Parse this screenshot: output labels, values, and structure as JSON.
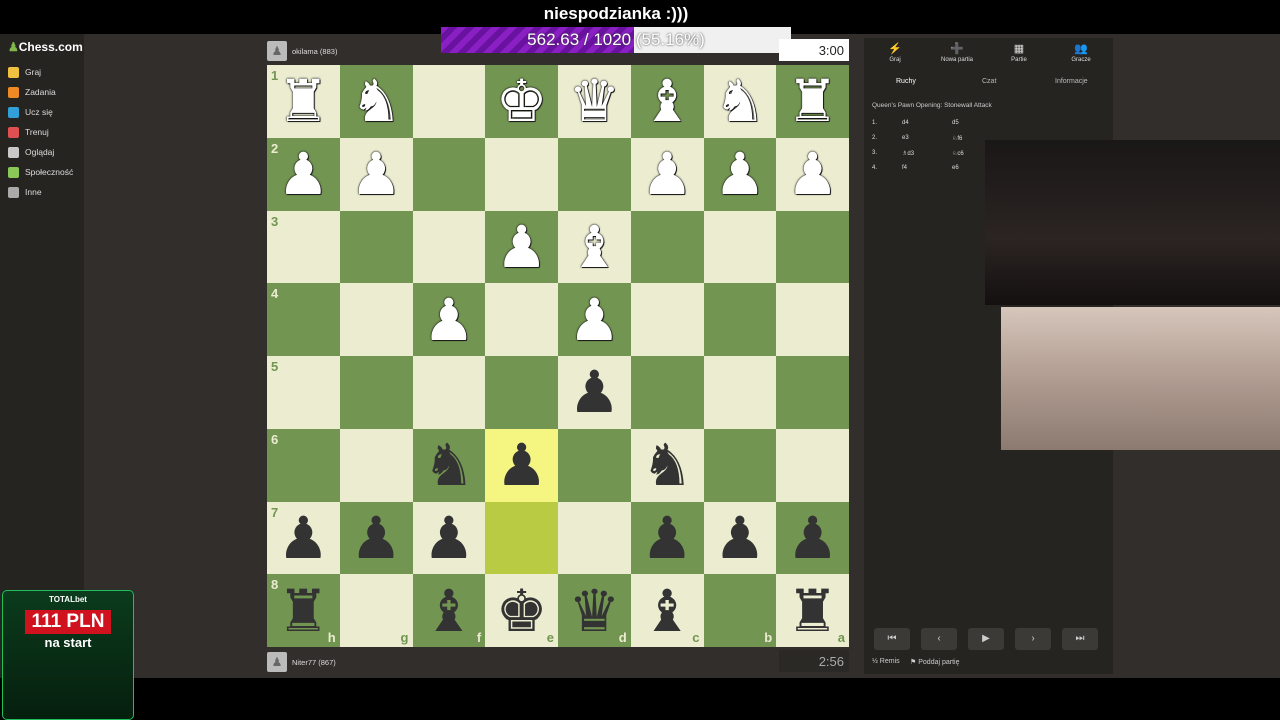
{
  "stream": {
    "title": "niespodzianka :)))",
    "goal_text": "562.63 / 1020 (55.16%)",
    "goal_fraction": 0.5516
  },
  "sidebar": {
    "logo": "Chess.com",
    "items": [
      {
        "label": "Graj",
        "color": "#f0c040"
      },
      {
        "label": "Zadania",
        "color": "#f08a24"
      },
      {
        "label": "Ucz się",
        "color": "#32a0d8"
      },
      {
        "label": "Trenuj",
        "color": "#e05050"
      },
      {
        "label": "Oglądaj",
        "color": "#c8c8c8"
      },
      {
        "label": "Społeczność",
        "color": "#8ac858"
      },
      {
        "label": "Inne",
        "color": "#aaaaaa"
      }
    ]
  },
  "top_player": {
    "name": "okilama (883)",
    "clock": "3:00"
  },
  "bottom_player": {
    "name": "Niter77 (867)",
    "clock": "2:56"
  },
  "board": {
    "ranks": [
      "1",
      "2",
      "3",
      "4",
      "5",
      "6",
      "7",
      "8"
    ],
    "files": [
      "h",
      "g",
      "f",
      "e",
      "d",
      "c",
      "b",
      "a"
    ],
    "rows": [
      [
        "wR",
        "wN",
        "",
        "wK",
        "wQ",
        "wB",
        "wN",
        "wR"
      ],
      [
        "wP",
        "wP",
        "",
        "",
        "",
        "wP",
        "wP",
        "wP"
      ],
      [
        "",
        "",
        "",
        "wP",
        "wB",
        "",
        "",
        ""
      ],
      [
        "",
        "",
        "wP",
        "",
        "wP",
        "",
        "",
        ""
      ],
      [
        "",
        "",
        "",
        "",
        "bP",
        "",
        "",
        ""
      ],
      [
        "",
        "",
        "bN",
        "bP",
        "",
        "bN",
        "",
        ""
      ],
      [
        "bP",
        "bP",
        "bP",
        "",
        "",
        "bP",
        "bP",
        "bP"
      ],
      [
        "bR",
        "",
        "bB",
        "bK",
        "bQ",
        "bB",
        "",
        "bR"
      ]
    ],
    "highlights": [
      "5,3",
      "6,3"
    ]
  },
  "panel": {
    "tabs": [
      {
        "label": "Graj",
        "icon": "⚡"
      },
      {
        "label": "Nowa partia",
        "icon": "➕"
      },
      {
        "label": "Partie",
        "icon": "▦"
      },
      {
        "label": "Gracze",
        "icon": "👥"
      }
    ],
    "subtabs": [
      "Ruchy",
      "Czat",
      "Informacje"
    ],
    "opening": "Queen's Pawn Opening: Stonewall Attack",
    "moves": [
      {
        "num": "1.",
        "white": "d4",
        "black": "d5"
      },
      {
        "num": "2.",
        "white": "e3",
        "black": "♘f6"
      },
      {
        "num": "3.",
        "white": "♗d3",
        "black": "♘c6"
      },
      {
        "num": "4.",
        "white": "f4",
        "black": "e6"
      }
    ],
    "controls": [
      "⏮",
      "‹",
      "▶",
      "›",
      "⏭"
    ],
    "draw_label": "Remis",
    "resign_label": "Poddaj partię"
  },
  "ad": {
    "brand": "TOTALbet",
    "amount": "111 PLN",
    "subtitle": "na start"
  }
}
